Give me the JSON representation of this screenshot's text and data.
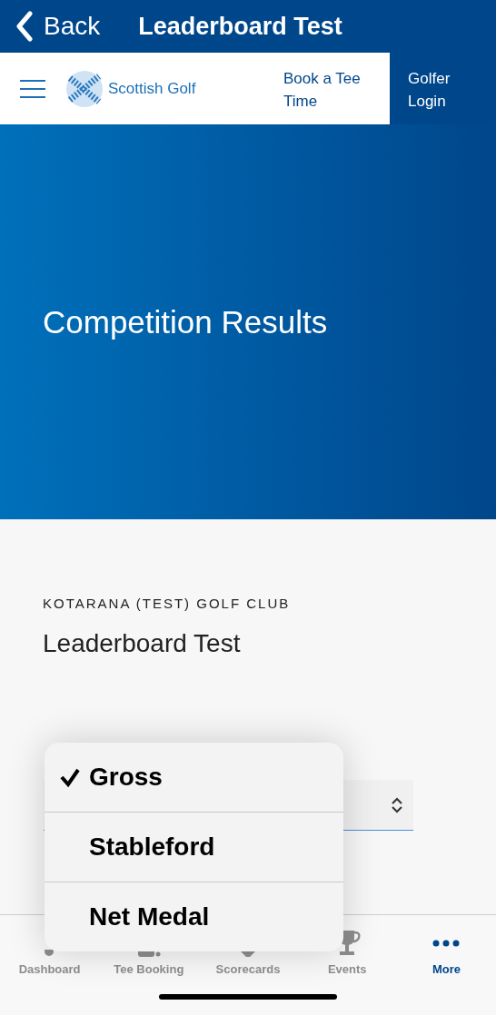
{
  "nav_bar": {
    "back_label": "Back",
    "title": "Leaderboard Test"
  },
  "header": {
    "logo_text": "Scottish Golf",
    "links": [
      {
        "label": "Book a Tee Time",
        "highlighted": false
      },
      {
        "label": "Golfer Login",
        "highlighted": true
      }
    ]
  },
  "hero": {
    "title": "Competition Results"
  },
  "content": {
    "club": "KOTARANA (TEST) GOLF CLUB",
    "competition": "Leaderboard Test"
  },
  "dropdown": {
    "options": [
      {
        "label": "Gross",
        "selected": true
      },
      {
        "label": "Stableford",
        "selected": false
      },
      {
        "label": "Net Medal",
        "selected": false
      }
    ]
  },
  "tab_bar": [
    {
      "label": "Dashboard",
      "kind": "dashboard",
      "selected": false
    },
    {
      "label": "Tee Booking",
      "kind": "booking",
      "selected": false
    },
    {
      "label": "Scorecards",
      "kind": "scorecards",
      "selected": false
    },
    {
      "label": "Events",
      "kind": "events",
      "selected": false
    },
    {
      "label": "More",
      "kind": "more",
      "selected": true
    }
  ]
}
